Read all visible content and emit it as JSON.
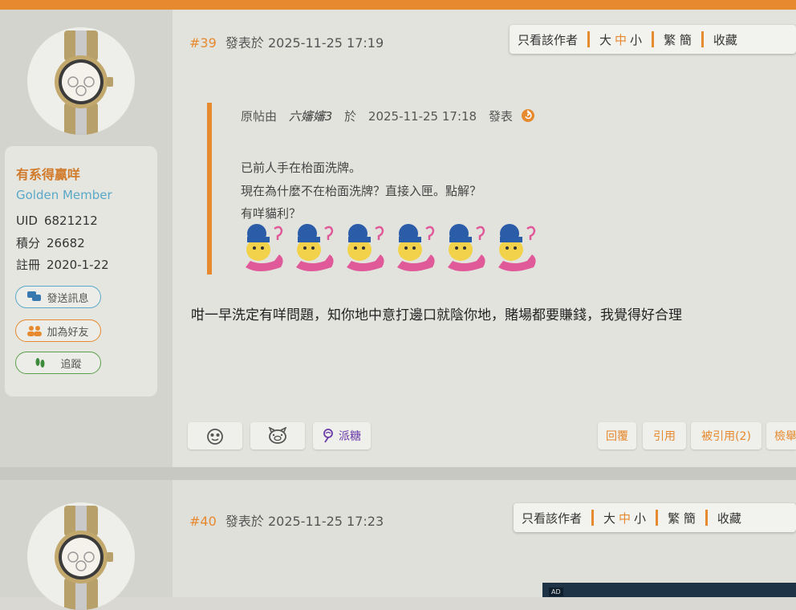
{
  "colors": {
    "accent": "#e6892f",
    "member": "#58a8c8",
    "text": "#333333"
  },
  "user": {
    "name": "有系得贏咩",
    "group": "Golden Member",
    "uid_label": "UID",
    "uid": "6821212",
    "points_label": "積分",
    "points": "26682",
    "reg_label": "註冊",
    "reg_date": "2020-1-22",
    "buttons": {
      "message": "發送訊息",
      "message_icon": "chat-icon",
      "friend": "加為好友",
      "friend_icon": "people-icon",
      "follow": "追蹤",
      "follow_icon": "footsteps-icon"
    }
  },
  "toolbar": {
    "author_only": "只看該作者",
    "size_large": "大",
    "size_medium": "中",
    "size_small": "小",
    "trad_simp": "繁 簡",
    "favorite": "收藏"
  },
  "post": {
    "number": "#39",
    "posted_label": "發表於",
    "time": "2025-11-25 17:19",
    "quote": {
      "prefix": "原帖由",
      "author": "六嬸嬸3",
      "on": "於",
      "time": "2025-11-25  17:18",
      "suffix": "發表",
      "jump_icon": "jump-to-post-icon",
      "lines": [
        "已前人手在枱面洗牌。",
        "現在為什麼不在枱面洗牌？直接入匣。點解？",
        "有咩貓利？"
      ],
      "emoji_name": "confused-face-sticker",
      "emoji_count": 6
    },
    "content": "咁一早洗定有咩問題，知你地中意打邊口就陰你地，賭場都要賺錢，我覺得好合理",
    "reactions": {
      "react1_icon": "smiley-face-icon",
      "react2_icon": "pig-face-icon",
      "candy_icon": "lollipop-icon",
      "candy": "派糖"
    },
    "actions": {
      "reply": "回覆",
      "quote": "引用",
      "quoted": "被引用(2)",
      "report": "檢舉"
    }
  },
  "next_post": {
    "number": "#40",
    "posted_label": "發表於",
    "time": "2025-11-25 17:23",
    "ad_label": "AD"
  }
}
